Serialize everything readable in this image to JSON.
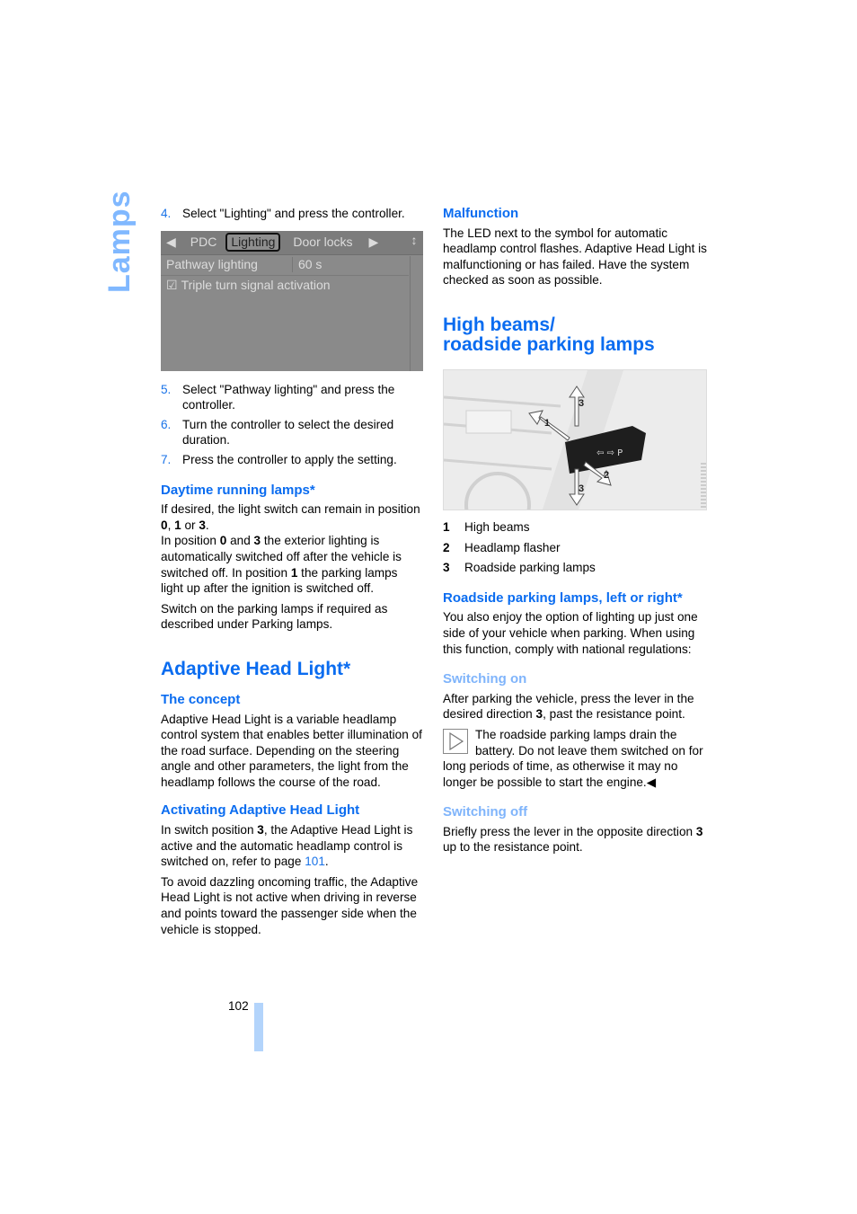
{
  "side_tab": "Lamps",
  "left": {
    "step4": {
      "num": "4.",
      "text": "Select \"Lighting\" and press the controller."
    },
    "screen": {
      "tabs": [
        "PDC",
        "Lighting",
        "Door locks"
      ],
      "active_tab": "Lighting",
      "row1_label": "Pathway lighting",
      "row1_value": "60 s",
      "row2_label": "Triple turn signal activation"
    },
    "steps": [
      {
        "num": "5.",
        "text": "Select \"Pathway lighting\" and press the controller."
      },
      {
        "num": "6.",
        "text": "Turn the controller to select the desired duration."
      },
      {
        "num": "7.",
        "text": "Press the controller to apply the setting."
      }
    ],
    "drl_heading": "Daytime running lamps*",
    "drl_p1a": "If desired, the light switch can remain in position ",
    "drl_p1b": "0",
    "drl_p1c": ", ",
    "drl_p1d": "1",
    "drl_p1e": " or ",
    "drl_p1f": "3",
    "drl_p1g": ".",
    "drl_p2a": "In position ",
    "drl_p2b": "0",
    "drl_p2c": " and ",
    "drl_p2d": "3",
    "drl_p2e": " the exterior lighting is automatically switched off after the vehicle is switched off. In position ",
    "drl_p2f": "1",
    "drl_p2g": " the parking lamps light up after the ignition is switched off.",
    "drl_p3": "Switch on the parking lamps if required as described under Parking lamps.",
    "ahl_heading": "Adaptive Head Light*",
    "concept_heading": "The concept",
    "concept_text": "Adaptive Head Light is a variable headlamp control system that enables better illumination of the road surface. Depending on the steering angle and other parameters, the light from the headlamp follows the course of the road.",
    "activating_heading": "Activating Adaptive Head Light",
    "act_p1a": "In switch position ",
    "act_p1b": "3",
    "act_p1c": ", the Adaptive Head Light is active and the automatic headlamp control is switched on, refer to page ",
    "act_p1_link": "101",
    "act_p1d": ".",
    "act_p2": "To avoid dazzling oncoming traffic, the Adaptive Head Light is not active when driving in reverse and points toward the passenger side when the vehicle is stopped."
  },
  "right": {
    "malfunction_heading": "Malfunction",
    "malfunction_text": "The LED next to the symbol for automatic headlamp control flashes. Adaptive Head Light is malfunctioning or has failed. Have the system checked as soon as possible.",
    "hb_heading_line1": "High beams/",
    "hb_heading_line2": "roadside parking lamps",
    "legend": [
      {
        "num": "1",
        "text": "High beams"
      },
      {
        "num": "2",
        "text": "Headlamp flasher"
      },
      {
        "num": "3",
        "text": "Roadside parking lamps"
      }
    ],
    "rpl_heading": "Roadside parking lamps, left or right*",
    "rpl_text": "You also enjoy the option of lighting up just one side of your vehicle when parking. When using this function, comply with national regulations:",
    "on_heading": "Switching on",
    "on_a": "After parking the vehicle, press the lever in the desired direction ",
    "on_b": "3",
    "on_c": ", past the resistance point.",
    "note": "The roadside parking lamps drain the battery. Do not leave them switched on for long periods of time, as otherwise it may no longer be possible to start the engine.",
    "off_heading": "Switching off",
    "off_a": "Briefly press the lever in the opposite direction ",
    "off_b": "3",
    "off_c": " up to the resistance point."
  },
  "page_number": "102"
}
